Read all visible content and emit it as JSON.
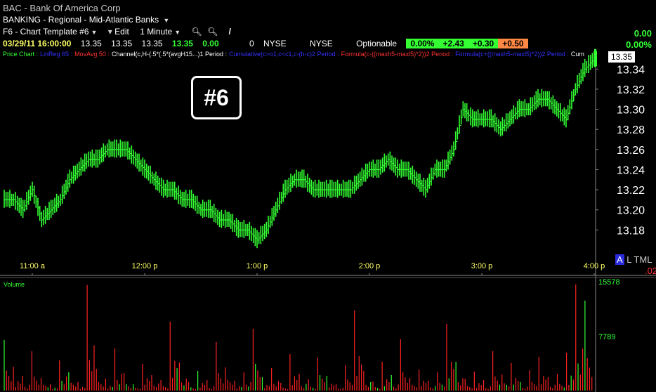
{
  "symbol": {
    "ticker": "BAC",
    "separator": "-",
    "name": "Bank Of America Corp",
    "sector": "BANKING - Regional - Mid-Atlantic Banks"
  },
  "toolbar": {
    "template": "F6 - Chart Template #6",
    "edit": "Edit",
    "interval": "1 Minute"
  },
  "quote": {
    "datetime": "03/29/11 16:00:00",
    "open": "13.35",
    "high": "13.35",
    "low": "13.35",
    "last": "13.35",
    "change": "0.00",
    "volume": "0",
    "exchange1": "NYSE",
    "exchange2": "NYSE",
    "optionable": "Optionable",
    "pct_change": "0.00%",
    "pill1": "+2.43",
    "pill2": "+0.30",
    "pill3": "+0.50",
    "right_change": "0.00",
    "right_pct": "0.00%"
  },
  "legend": {
    "items": [
      {
        "text": "Price Chart",
        "color": "#33ff33"
      },
      {
        "text": "LinReg 65",
        "color": "#3333ff"
      },
      {
        "text": "MovAvg 50",
        "color": "#ff3333"
      },
      {
        "text": "Channel(c,H-(.5*(.5*(avgH15...)1 Period",
        "color": "#ffffff"
      },
      {
        "text": "Cumulative(c>o1,c<c1,c-(h-c)2 Period",
        "color": "#3333ff"
      },
      {
        "text": "Formula(c-((maxh5-maxl5)*2))2 Period",
        "color": "#ff3333"
      },
      {
        "text": "Formula(c+((maxh5-maxl5)*2))2 Period",
        "color": "#3333ff"
      },
      {
        "text": "Cum",
        "color": "#ffffff"
      }
    ]
  },
  "annotation": "#6",
  "last_price_label": "13.35",
  "marker": {
    "a": "A",
    "rest": "L TML",
    "red": ".02"
  },
  "colors": {
    "price": "#33ff33",
    "volume": "#ff2222",
    "volume_up": "#33ff33",
    "axis_text": "#ffffff",
    "time_text": "#ffff66"
  },
  "chart_data": [
    {
      "type": "line",
      "title": "",
      "x": [
        "10:45",
        "10:50",
        "10:55",
        "11:00",
        "11:05",
        "11:10",
        "11:15",
        "11:20",
        "11:25",
        "11:30",
        "11:35",
        "11:40",
        "11:45",
        "11:50",
        "11:55",
        "12:00",
        "12:05",
        "12:10",
        "12:15",
        "12:20",
        "12:25",
        "12:30",
        "12:35",
        "12:40",
        "12:45",
        "12:50",
        "12:55",
        "13:00",
        "13:05",
        "13:10",
        "13:15",
        "13:20",
        "13:25",
        "13:30",
        "13:35",
        "13:40",
        "13:45",
        "13:50",
        "13:55",
        "14:00",
        "14:05",
        "14:10",
        "14:15",
        "14:20",
        "14:25",
        "14:30",
        "14:35",
        "14:40",
        "14:45",
        "14:50",
        "14:55",
        "15:00",
        "15:05",
        "15:10",
        "15:15",
        "15:20",
        "15:25",
        "15:30",
        "15:35",
        "15:40",
        "15:45",
        "15:50",
        "15:55",
        "16:00"
      ],
      "values": [
        13.21,
        13.2,
        13.22,
        13.19,
        13.2,
        13.21,
        13.23,
        13.24,
        13.25,
        13.25,
        13.26,
        13.26,
        13.26,
        13.25,
        13.24,
        13.23,
        13.22,
        13.22,
        13.21,
        13.21,
        13.2,
        13.2,
        13.19,
        13.19,
        13.18,
        13.18,
        13.17,
        13.18,
        13.2,
        13.22,
        13.23,
        13.23,
        13.22,
        13.22,
        13.22,
        13.22,
        13.22,
        13.23,
        13.24,
        13.24,
        13.25,
        13.24,
        13.24,
        13.23,
        13.22,
        13.24,
        13.24,
        13.26,
        13.3,
        13.29,
        13.29,
        13.29,
        13.28,
        13.29,
        13.3,
        13.3,
        13.31,
        13.31,
        13.3,
        13.29,
        13.32,
        13.34,
        13.35,
        13.35
      ],
      "series": [
        {
          "name": "Price Chart",
          "values": []
        }
      ],
      "y_ticks": [
        "13.34",
        "13.32",
        "13.30",
        "13.28",
        "13.26",
        "13.24",
        "13.22",
        "13.20",
        "13.18"
      ],
      "x_ticks": [
        "11:00 a",
        "12:00 p",
        "1:00 p",
        "2:00 p",
        "3:00 p",
        "4:00 p"
      ],
      "ylim": [
        13.16,
        13.35
      ],
      "xlabel": "",
      "ylabel": ""
    },
    {
      "type": "bar",
      "title": "Volume",
      "y_ticks": [
        "15578",
        "7789"
      ],
      "ylim": [
        0,
        15578
      ],
      "values": [
        7200,
        3400,
        2100,
        5600,
        1800,
        900,
        4300,
        2600,
        1200,
        15000,
        3100,
        1700,
        6000,
        2500,
        900,
        3800,
        2200,
        1500,
        9800,
        4000,
        1200,
        2800,
        1500,
        6900,
        3300,
        1400,
        2600,
        8800,
        1900,
        3200,
        1100,
        5200,
        2400,
        1600,
        4700,
        2100,
        900,
        3600,
        11400,
        2800,
        1300,
        4100,
        2200,
        7300,
        1800,
        3000,
        1400,
        2600,
        9500,
        4100,
        1700,
        2700,
        1500,
        5600,
        2300,
        3900,
        1200,
        2900,
        4800,
        1900,
        2400,
        5400,
        15100,
        12800
      ]
    }
  ]
}
